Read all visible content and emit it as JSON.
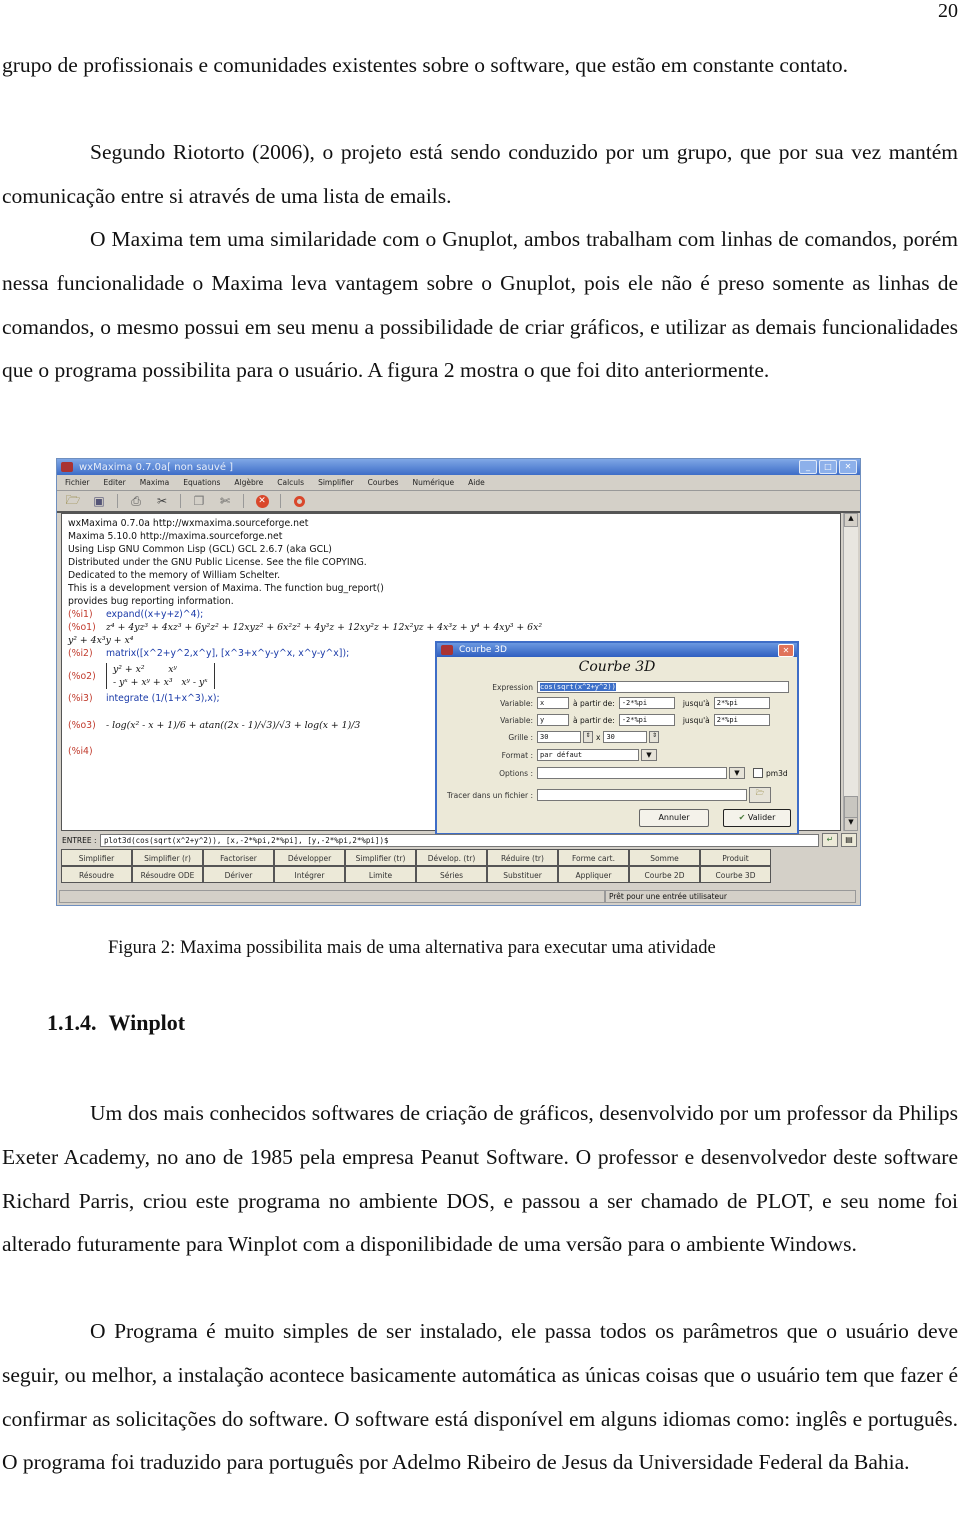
{
  "page_number": "20",
  "paragraphs": [
    "grupo de profissionais e comunidades existentes sobre o software, que estão em constante contato.",
    "Segundo Riotorto (2006), o projeto está sendo conduzido por um grupo, que por sua vez mantém comunicação entre si através de uma lista de emails.",
    "O Maxima tem uma similaridade com o Gnuplot, ambos trabalham com linhas de comandos, porém nessa funcionalidade o Maxima leva vantagem sobre o Gnuplot, pois ele não é preso somente as linhas de comandos, o mesmo possui em seu menu a possibilidade de criar gráficos, e utilizar as demais funcionalidades que o programa possibilita para o usuário. A figura 2 mostra o que foi dito anteriormente."
  ],
  "figure": {
    "caption": "Figura 2: Maxima possibilita mais de uma alternativa para executar uma atividade",
    "window": {
      "title": "wxMaxima 0.7.0a[ non sauvé ]",
      "menu": [
        "Fichier",
        "Editer",
        "Maxima",
        "Equations",
        "Algèbre",
        "Calculs",
        "Simplifier",
        "Courbes",
        "Numérique",
        "Aide"
      ],
      "toolbar_icons": [
        "open-folder-icon",
        "save-icon",
        "print-icon",
        "configure-icon",
        "copy-icon",
        "cut-icon",
        "stop-icon",
        "help-lifebuoy-icon"
      ],
      "banner": [
        "wxMaxima 0.7.0a http://wxmaxima.sourceforge.net",
        "Maxima 5.10.0 http://maxima.sourceforge.net",
        "Using Lisp GNU Common Lisp (GCL) GCL 2.6.7 (aka GCL)",
        "Distributed under the GNU Public License. See the file COPYING.",
        "Dedicated to the memory of William Schelter.",
        "This is a development version of Maxima. The function bug_report()",
        "provides bug reporting information."
      ],
      "cells": {
        "i1_label": "(%i1)",
        "i1": "expand((x+y+z)^4);",
        "o1_label": "(%o1)",
        "o1": "z⁴ + 4yz³ + 4xz³ + 6y²z² + 12xyz² + 6x²z² + 4y³z + 12xy²z + 12x²yz + 4x³z + y⁴ + 4xy³ + 6x²",
        "o1_cont": "y² + 4x³y + x⁴",
        "i2_label": "(%i2)",
        "i2": "matrix([x^2+y^2,x^y], [x^3+x^y-y^x, x^y-y^x]);",
        "o2_label": "(%o2)",
        "o2_row1": "y² + x²        xʸ",
        "o2_row2": "- yˣ + xʸ + x³   xʸ - yˣ",
        "i3_label": "(%i3)",
        "i3": "integrate (1/(1+x^3),x);",
        "o3_label": "(%o3)",
        "o3": "- log(x² - x + 1)/6 + atan((2x - 1)/√3)/√3 + log(x + 1)/3",
        "i4_label": "(%i4)"
      },
      "dialog": {
        "title": "Courbe 3D",
        "heading": "Courbe 3D",
        "expression_label": "Expression",
        "expression_value": "cos(sqrt(x^2+y^2))",
        "variable_label": "Variable:",
        "from_label": "à partir de:",
        "to_label": "jusqu'à",
        "var1": {
          "name": "x",
          "from": "-2*%pi",
          "to": "2*%pi"
        },
        "var2": {
          "name": "y",
          "from": "-2*%pi",
          "to": "2*%pi"
        },
        "grid_label": "Grille :",
        "grid_x": "30",
        "grid_times": "x",
        "grid_y": "30",
        "format_label": "Format :",
        "format_value": "par défaut",
        "options_label": "Options :",
        "options_value": "",
        "pm3d_label": "pm3d",
        "pm3d_checked": false,
        "file_label": "Tracer dans un fichier :",
        "file_value": "",
        "cancel": "Annuler",
        "ok": "Valider"
      },
      "entry_label": "ENTREE :",
      "entry_value": "plot3d(cos(sqrt(x^2+y^2)), [x,-2*%pi,2*%pi], [y,-2*%pi,2*%pi])$",
      "buttons": [
        "Simplifier",
        "Simplifier (r)",
        "Factoriser",
        "Développer",
        "Simplifier (tr)",
        "Dévelop. (tr)",
        "Réduire (tr)",
        "Forme cart.",
        "Somme",
        "Produit",
        "Résoudre",
        "Résoudre ODE",
        "Dériver",
        "Intégrer",
        "Limite",
        "Séries",
        "Substituer",
        "Appliquer",
        "Courbe 2D",
        "Courbe 3D"
      ],
      "status": "Prêt pour une entrée utilisateur"
    }
  },
  "section": {
    "number": "1.1.4.",
    "title": "Winplot"
  },
  "paragraphs2": [
    "Um dos mais conhecidos softwares de criação de gráficos, desenvolvido por um professor da Philips Exeter Academy, no ano de 1985 pela empresa Peanut Software. O professor e desenvolvedor deste software Richard Parris, criou este programa no ambiente DOS, e passou a ser chamado de PLOT, e seu nome foi alterado futuramente para Winplot com a disponilibidade de uma versão para o ambiente Windows.",
    "O Programa é muito simples de ser instalado, ele passa todos os parâmetros que o usuário deve seguir, ou melhor, a instalação acontece basicamente automática as únicas coisas que o usuário tem que fazer é confirmar as solicitações do software. O software está disponível em alguns idiomas como: inglês e português. O programa foi traduzido para português por Adelmo Ribeiro de Jesus da Universidade Federal da Bahia."
  ]
}
